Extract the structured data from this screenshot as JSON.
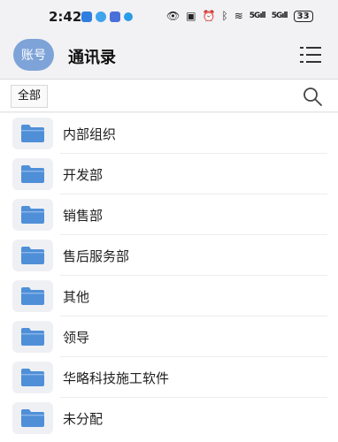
{
  "status": {
    "time": "2:42",
    "signal1": "5G",
    "signal2": "5G",
    "battery": "33"
  },
  "header": {
    "avatar_label": "账号",
    "title": "通讯录",
    "menu_icon": "list-menu-icon"
  },
  "filter": {
    "chip_label": "全部",
    "search_icon": "search-icon"
  },
  "groups": [
    {
      "label": "内部组织"
    },
    {
      "label": "开发部"
    },
    {
      "label": "销售部"
    },
    {
      "label": "售后服务部"
    },
    {
      "label": "其他"
    },
    {
      "label": "领导"
    },
    {
      "label": "华略科技施工软件"
    },
    {
      "label": "未分配"
    }
  ],
  "colors": {
    "folder": "#4f8fd8",
    "avatar": "#7ea3d8"
  }
}
